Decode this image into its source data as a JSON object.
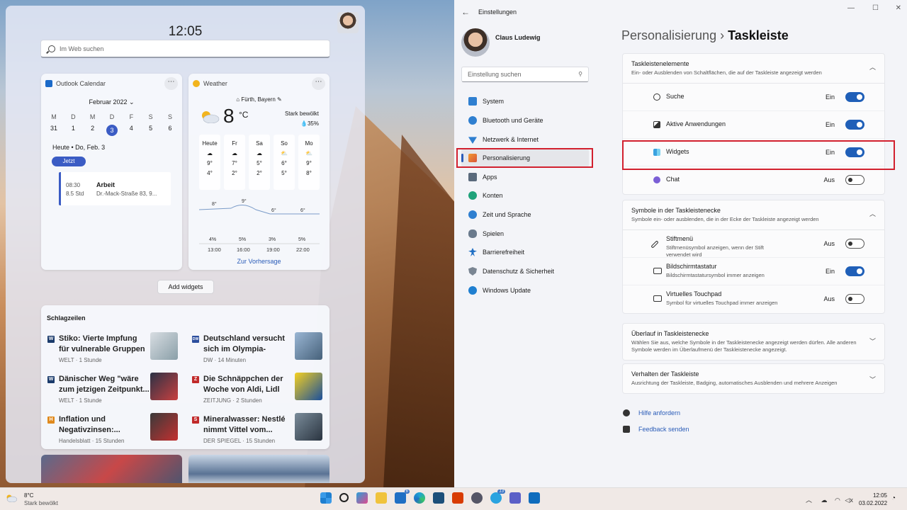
{
  "widgets": {
    "time": "12:05",
    "search_placeholder": "Im Web suchen",
    "calendar": {
      "title": "Outlook Calendar",
      "month": "Februar 2022 ⌄",
      "weekday_heads": [
        "M",
        "D",
        "M",
        "D",
        "F",
        "S",
        "S"
      ],
      "days": [
        "31",
        "1",
        "2",
        "3",
        "4",
        "5",
        "6"
      ],
      "today_label": "Heute • Do, Feb. 3",
      "now_button": "Jetzt",
      "event": {
        "time": "08:30",
        "duration": "8.5 Std",
        "title": "Arbeit",
        "location": "Dr.-Mack-Straße 83, 9..."
      }
    },
    "weather": {
      "title": "Weather",
      "location": "Fürth, Bayern",
      "temp": "8",
      "unit": "°C",
      "condition": "Stark bewölkt",
      "precip": "35%",
      "days": [
        {
          "name": "Heute",
          "hi": "9°",
          "lo": "4°"
        },
        {
          "name": "Fr",
          "hi": "7°",
          "lo": "2°"
        },
        {
          "name": "Sa",
          "hi": "5°",
          "lo": "2°"
        },
        {
          "name": "So",
          "hi": "6°",
          "lo": "5°"
        },
        {
          "name": "Mo",
          "hi": "9°",
          "lo": "8°"
        }
      ],
      "hourly_temps": [
        "8°",
        "9°",
        "6°",
        "6°"
      ],
      "hourly_precip": [
        "4%",
        "5%",
        "3%",
        "5%"
      ],
      "hours": [
        "13:00",
        "16:00",
        "19:00",
        "22:00"
      ],
      "forecast_link": "Zur Vorhersage"
    },
    "add_widgets": "Add widgets",
    "news": {
      "heading": "Schlagzeilen",
      "items": [
        {
          "src": "W",
          "title": "Stiko: Vierte Impfung für vulnerable Gruppen –...",
          "meta": "WELT · 1 Stunde"
        },
        {
          "src": "DW",
          "title": "Deutschland versucht sich im Olympia-Boyko...",
          "meta": "DW · 14 Minuten"
        },
        {
          "src": "W",
          "title": "Dänischer Weg \"wäre zum jetzigen Zeitpunkt...",
          "meta": "WELT · 1 Stunde"
        },
        {
          "src": "Z",
          "title": "Die Schnäppchen der Woche von Aldi, Lidl un...",
          "meta": "ZEITJUNG · 2 Stunden"
        },
        {
          "src": "H",
          "title": "Inflation und Negativzinsen:...",
          "meta": "Handelsblatt · 15 Stunden"
        },
        {
          "src": "S",
          "title": "Mineralwasser: Nestlé nimmt Vittel vom...",
          "meta": "DER SPIEGEL · 15 Stunden"
        }
      ]
    }
  },
  "settings": {
    "app_title": "Einstellungen",
    "user": "Claus Ludewig",
    "search_placeholder": "Einstellung suchen",
    "nav": [
      "System",
      "Bluetooth und Geräte",
      "Netzwerk & Internet",
      "Personalisierung",
      "Apps",
      "Konten",
      "Zeit und Sprache",
      "Spielen",
      "Barrierefreiheit",
      "Datenschutz & Sicherheit",
      "Windows Update"
    ],
    "breadcrumb_parent": "Personalisierung",
    "breadcrumb_current": "Taskleiste",
    "taskbar_items": {
      "title": "Taskleistenelemente",
      "subtitle": "Ein- oder Ausblenden von Schaltflächen, die auf der Taskleiste angezeigt werden",
      "rows": [
        {
          "label": "Suche",
          "state": "Ein"
        },
        {
          "label": "Aktive Anwendungen",
          "state": "Ein"
        },
        {
          "label": "Widgets",
          "state": "Ein"
        },
        {
          "label": "Chat",
          "state": "Aus"
        }
      ]
    },
    "corner_icons": {
      "title": "Symbole in der Taskleistenecke",
      "subtitle": "Symbole ein- oder ausblenden, die in der Ecke der Taskleiste angezeigt werden",
      "rows": [
        {
          "label": "Stiftmenü",
          "desc": "Stiftmenüsymbol anzeigen, wenn der Stift verwendet wird",
          "state": "Aus"
        },
        {
          "label": "Bildschirmtastatur",
          "desc": "Bildschirmtastatursymbol immer anzeigen",
          "state": "Ein"
        },
        {
          "label": "Virtuelles Touchpad",
          "desc": "Symbol für virtuelles Touchpad immer anzeigen",
          "state": "Aus"
        }
      ]
    },
    "overflow": {
      "title": "Überlauf in Taskleistenecke",
      "subtitle": "Wählen Sie aus, welche Symbole in der Taskleistenecke angezeigt werden dürfen. Alle anderen Symbole werden im Überlaufmenü der Taskleistenecke angezeigt."
    },
    "behavior": {
      "title": "Verhalten der Taskleiste",
      "subtitle": "Ausrichtung der Taskleiste, Badging, automatisches Ausblenden und mehrere Anzeigen"
    },
    "help": "Hilfe anfordern",
    "feedback": "Feedback senden"
  },
  "taskbar": {
    "weather_temp": "8°C",
    "weather_desc": "Stark bewölkt",
    "store_badge": "6",
    "telegram_badge": "13",
    "time": "12:05",
    "date": "03.02.2022"
  }
}
